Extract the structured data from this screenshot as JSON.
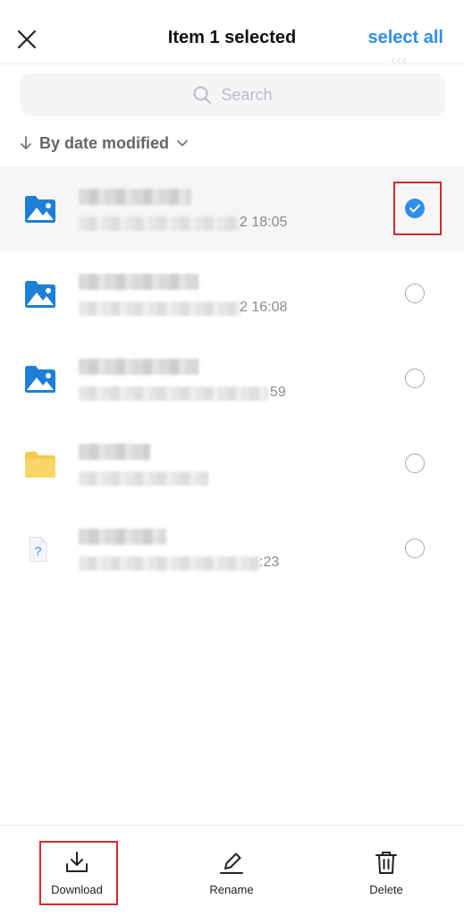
{
  "header": {
    "title": "Item 1 selected",
    "select_all_label": "select all"
  },
  "search": {
    "placeholder": "Search"
  },
  "sort": {
    "label": "By date modified"
  },
  "files": [
    {
      "icon": "image-folder-icon",
      "meta_suffix": "2 18:05",
      "selected": true
    },
    {
      "icon": "image-folder-icon",
      "meta_suffix": "2 16:08",
      "selected": false
    },
    {
      "icon": "image-folder-icon",
      "meta_suffix": "59",
      "selected": false
    },
    {
      "icon": "folder-icon",
      "meta_suffix": "",
      "selected": false
    },
    {
      "icon": "unknown-file-icon",
      "meta_suffix": ":23",
      "selected": false
    }
  ],
  "toolbar": {
    "download_label": "Download",
    "rename_label": "Rename",
    "delete_label": "Delete"
  },
  "colors": {
    "accent": "#2f8eea",
    "highlight": "#d12a2a",
    "folder_yellow": "#f8d66a"
  }
}
